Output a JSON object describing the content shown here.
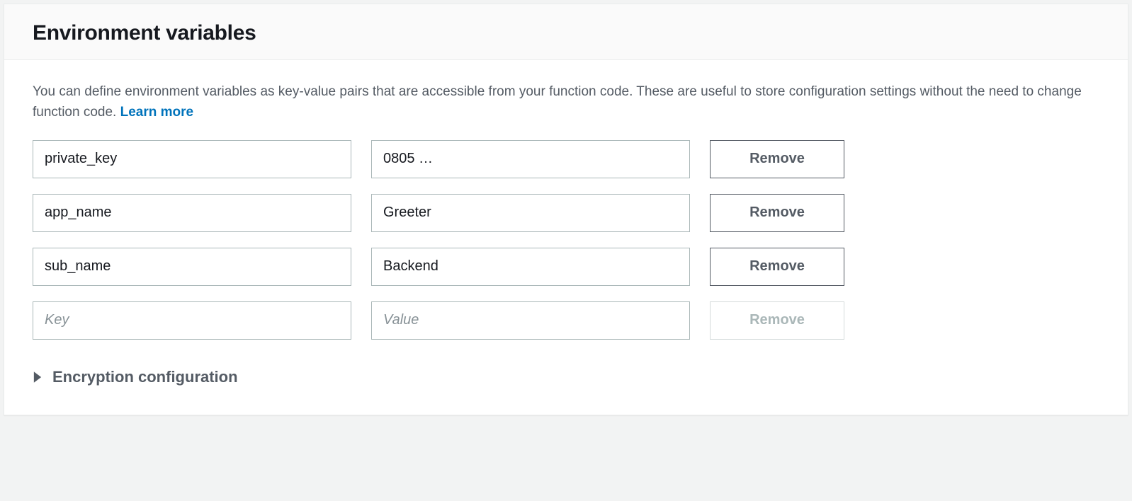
{
  "header": {
    "title": "Environment variables"
  },
  "description": {
    "text_before_link": "You can define environment variables as key-value pairs that are accessible from your function code. These are useful to store configuration settings without the need to change function code. ",
    "link_label": "Learn more"
  },
  "buttons": {
    "remove_label": "Remove"
  },
  "placeholders": {
    "key": "Key",
    "value": "Value"
  },
  "rows": [
    {
      "key": "private_key",
      "value": "0805 …"
    },
    {
      "key": "app_name",
      "value": "Greeter"
    },
    {
      "key": "sub_name",
      "value": "Backend"
    }
  ],
  "expander": {
    "label": "Encryption configuration"
  }
}
